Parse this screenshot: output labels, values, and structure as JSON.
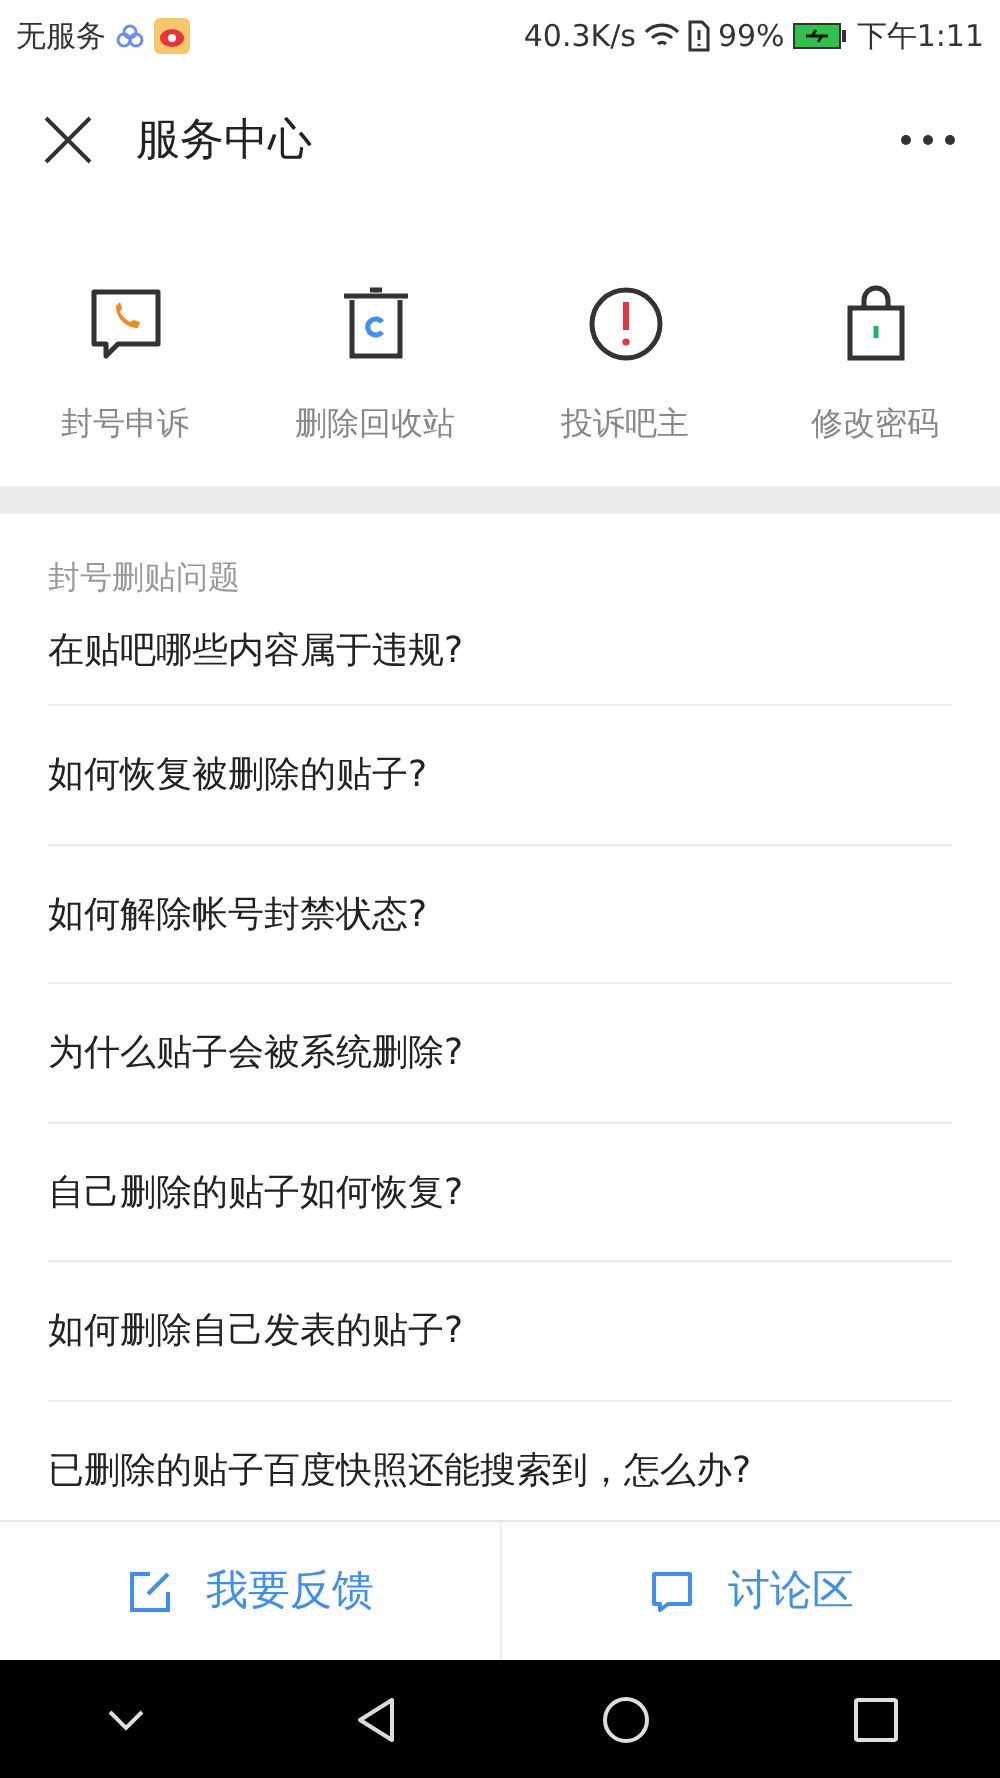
{
  "status_bar": {
    "carrier": "无服务",
    "speed": "40.3K/s",
    "battery": "99%",
    "time": "下午1:11"
  },
  "header": {
    "title": "服务中心"
  },
  "shortcuts": [
    {
      "kind": "appeal",
      "label": "封号申诉"
    },
    {
      "kind": "recycle",
      "label": "删除回收站"
    },
    {
      "kind": "report",
      "label": "投诉吧主"
    },
    {
      "kind": "password",
      "label": "修改密码"
    }
  ],
  "section": {
    "title": "封号删贴问题",
    "items": [
      "在贴吧哪些内容属于违规?",
      "如何恢复被删除的贴子?",
      "如何解除帐号封禁状态?",
      "为什么贴子会被系统删除?",
      "自己删除的贴子如何恢复?",
      "如何删除自己发表的贴子?",
      "已删除的贴子百度快照还能搜索到，怎么办?"
    ]
  },
  "bottom_bar": [
    {
      "kind": "feedback",
      "label": "我要反馈"
    },
    {
      "kind": "discuss",
      "label": "讨论区"
    }
  ]
}
